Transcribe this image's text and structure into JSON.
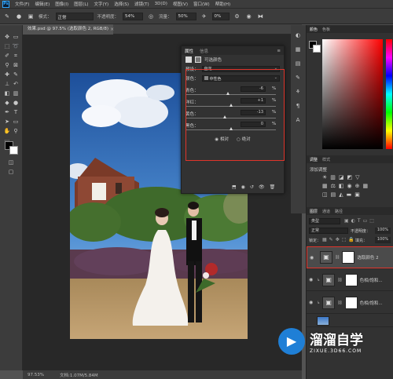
{
  "menubar": {
    "logo": "Ps",
    "items": [
      "文件(F)",
      "编辑(E)",
      "图像(I)",
      "图层(L)",
      "文字(Y)",
      "选择(S)",
      "滤镜(T)",
      "3D(D)",
      "视图(V)",
      "窗口(W)",
      "帮助(H)"
    ]
  },
  "options": {
    "mode_label": "模式：",
    "mode_value": "正常",
    "opacity_label": "不透明度：",
    "opacity_value": "54%",
    "flow_label": "流量：",
    "flow_value": "50%",
    "size_value": "0%"
  },
  "document": {
    "tab_title": "效果.psd @ 97.5% (选取颜色 2, RGB/8)",
    "zoom": "97.53%",
    "doc_size": "文档:1.07M/5.84M"
  },
  "properties": {
    "tab1": "属性",
    "tab2": "信息",
    "panel_title": "可选颜色",
    "preset_label": "预设：",
    "preset_value": "自定",
    "colors_label": "颜色：",
    "colors_value": "中性色",
    "sliders": [
      {
        "label": "青色：",
        "value": "-6",
        "pct": "%",
        "level": -6
      },
      {
        "label": "洋红：",
        "value": "+1",
        "pct": "%",
        "level": 1
      },
      {
        "label": "黄色：",
        "value": "-13",
        "pct": "%",
        "level": -13
      },
      {
        "label": "黑色：",
        "value": "0",
        "pct": "%",
        "level": 0
      }
    ],
    "relative": "相对",
    "absolute": "绝对"
  },
  "colorpanel": {
    "tab1": "颜色",
    "tab2": "色板"
  },
  "adjustments": {
    "tab1": "调整",
    "tab2": "样式",
    "add_label": "添加调整"
  },
  "layers": {
    "tab1": "图层",
    "tab2": "通道",
    "tab3": "路径",
    "kind": "类型",
    "blend": "正常",
    "opacity_label": "不透明度：",
    "opacity_value": "100%",
    "lock_label": "锁定：",
    "fill_label": "填充：",
    "fill_value": "100%",
    "rows": [
      {
        "name": "选取颜色 2",
        "icon": "adjustment-icon",
        "selected": true
      },
      {
        "name": "色相/饱和...",
        "icon": "adjustment-icon",
        "selected": false
      },
      {
        "name": "色相/饱和...",
        "icon": "adjustment-icon",
        "selected": false
      }
    ]
  },
  "watermark": {
    "brand": "溜溜自学",
    "url": "ZIXUE.3D66.COM"
  },
  "colors": {
    "accent": "#e0342b",
    "bg": "#535353",
    "panel": "#323232",
    "watermark": "#1f7fd6"
  }
}
